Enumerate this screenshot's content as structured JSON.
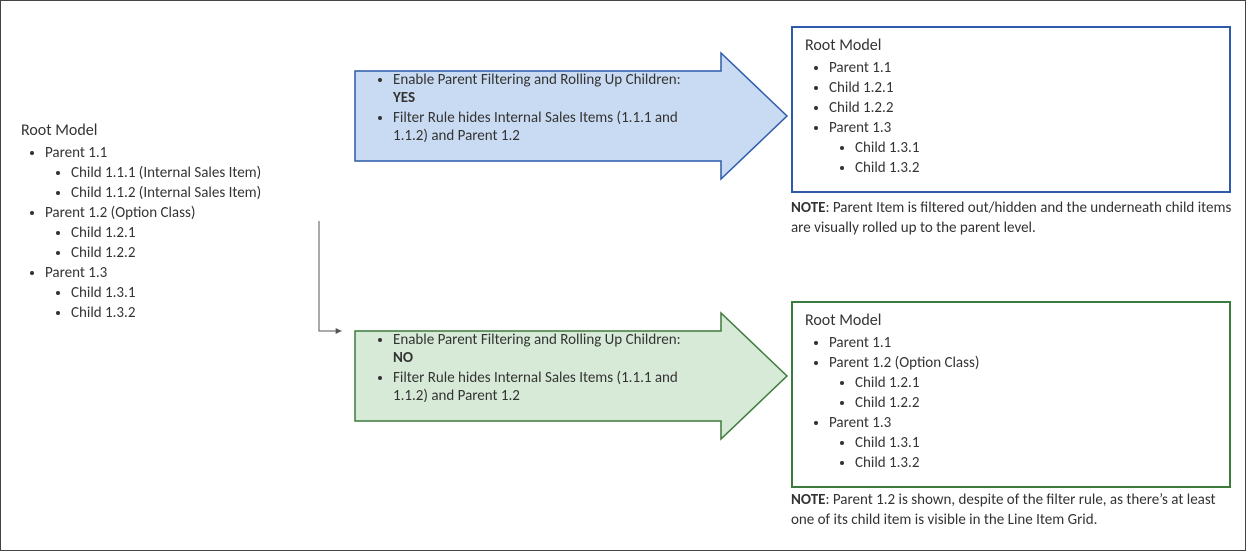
{
  "source": {
    "title": "Root Model",
    "items": [
      "Parent 1.1",
      "Child 1.1.1 (Internal Sales Item)",
      "Child 1.1.2 (Internal Sales Item)",
      "Parent 1.2 (Option Class)",
      "Child 1.2.1",
      "Child 1.2.2",
      "Parent 1.3",
      "Child 1.3.1",
      "Child 1.3.2"
    ]
  },
  "arrow_yes": {
    "line1_prefix": "Enable Parent Filtering and Rolling Up Children: ",
    "line1_value": "YES",
    "line2": "Filter Rule hides Internal Sales Items (1.1.1 and 1.1.2) and Parent 1.2",
    "fill": "#c9dbf2",
    "stroke": "#2e5aac"
  },
  "arrow_no": {
    "line1_prefix": "Enable Parent Filtering and Rolling Up Children: ",
    "line1_value": "NO",
    "line2": "Filter Rule hides Internal Sales Items (1.1.1 and 1.1.2) and Parent 1.2",
    "fill": "#d7ead7",
    "stroke": "#3d7a3d"
  },
  "result_yes": {
    "title": "Root Model",
    "items": [
      "Parent 1.1",
      "Child 1.2.1",
      "Child 1.2.2",
      "Parent 1.3",
      "Child 1.3.1",
      "Child 1.3.2"
    ],
    "note_label": "NOTE",
    "note_text": ": Parent Item is filtered out/hidden and the underneath child items are visually rolled up to the parent level."
  },
  "result_no": {
    "title": "Root Model",
    "items": [
      "Parent 1.1",
      "Parent 1.2 (Option Class)",
      "Child 1.2.1",
      "Child 1.2.2",
      "Parent 1.3",
      "Child 1.3.1",
      "Child 1.3.2"
    ],
    "note_label": "NOTE",
    "note_text": ": Parent 1.2 is shown, despite of the filter rule, as there’s at least one of its child item is visible in the Line Item Grid."
  }
}
